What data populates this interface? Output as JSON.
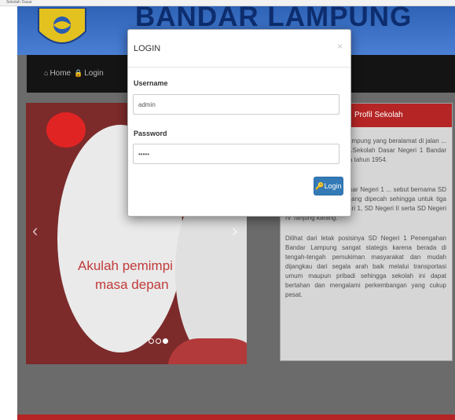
{
  "browser": {
    "tab_title": "Sekolah Dasar"
  },
  "header": {
    "title": "BANDAR LAMPUNG",
    "logo_icon": "school-emblem-icon"
  },
  "nav": {
    "items": [
      {
        "label": "Home",
        "icon": "home-icon"
      },
      {
        "label": "Login",
        "icon": "lock-icon"
      }
    ]
  },
  "slider": {
    "caption_line1": "Akulah pemimpi",
    "caption_line2": "masa depan"
  },
  "profile": {
    "title": "Profil Sekolah",
    "paragraphs": [
      "SD Negeri 1 Bandar Lampung yang beralamat di jalan ... Kota Bandar Lampung.Sekolah Dasar Negeri 1 Bandar Lampung didirikan pada tahun 1954.",
      "... menjadi Sekolah Dasar Negeri 1 ... sebut bernama SD No.7 Tanjung karang yang dipecah sehingga untuk tiga sekolah, yaitu SD Negeri 1, SD Negeri II serta SD Negeri IV Tanjung karang.",
      "Dilihat dari letak posisinya SD Negeri 1 Penengahan Bandar Lampung sangat stategis karena berada di tengah-tengah pemukiman masyarakat dan mudah dijangkau dari segala arah baik melalui transportasi umum maupun pribadi sehingga sekolah ini dapat bertahan dan mengalami perkembangan yang cukup pesat."
    ]
  },
  "modal": {
    "title": "LOGIN",
    "close": "×",
    "username_label": "Username",
    "username_value": "admin",
    "password_label": "Password",
    "password_value": "admin",
    "login_button": "Login",
    "login_icon": "key-icon",
    "login_icon_glyph": "🔑"
  },
  "colors": {
    "primary": "#337ab7",
    "header_blue": "#2e63b6",
    "accent_red": "#b52525",
    "nav_dark": "#141414"
  }
}
